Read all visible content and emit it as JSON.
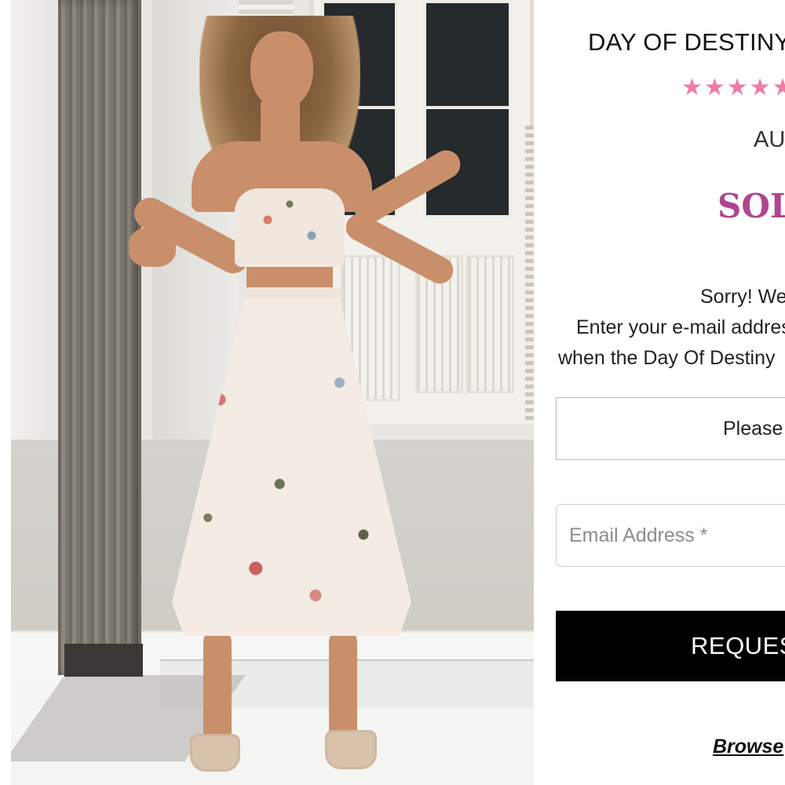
{
  "product": {
    "title": "DAY OF DESTINY",
    "rating_stars": "★★★★★",
    "rating_color": "#f07aa8",
    "price": "AU",
    "status": "SOLD OUT",
    "status_color": "#b0458f"
  },
  "notify": {
    "line1": "Sorry! We",
    "line2": "Enter your e-mail address",
    "line3": "when the Day Of Destiny"
  },
  "form": {
    "size_select_value": "Please s",
    "email_placeholder": "Email Address *",
    "submit_label": "REQUEST"
  },
  "links": {
    "browse_label": "Browse"
  },
  "image": {
    "description_icon": "product-photo"
  }
}
